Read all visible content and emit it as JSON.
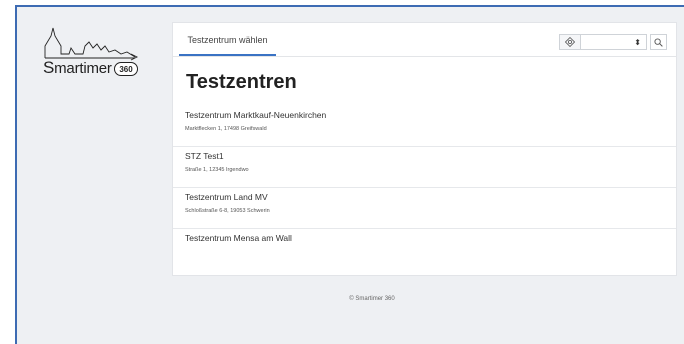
{
  "logo": {
    "text_s": "S",
    "text_rest": "martimer",
    "badge": "360"
  },
  "tabs": [
    {
      "label": "Testzentrum wählen"
    }
  ],
  "toolbar": {
    "locate_icon": "crosshair-icon",
    "range_value": "",
    "search_icon": "magnifier-icon"
  },
  "page": {
    "title": "Testzentren"
  },
  "centers": [
    {
      "name": "Testzentrum Marktkauf-Neuenkirchen",
      "address": "Marktflecken 1, 17498 Greifswald"
    },
    {
      "name": "STZ Test1",
      "address": "Straße 1, 12345 Irgendwo"
    },
    {
      "name": "Testzentrum Land MV",
      "address": "Schloßstraße 6-8, 19053 Schwerin"
    },
    {
      "name": "Testzentrum Mensa am Wall",
      "address": ""
    }
  ],
  "footer": {
    "text": "© Smartimer 360"
  },
  "colors": {
    "accent": "#3a73c4",
    "frame": "#3d6bb3",
    "background": "#eef0f3"
  }
}
